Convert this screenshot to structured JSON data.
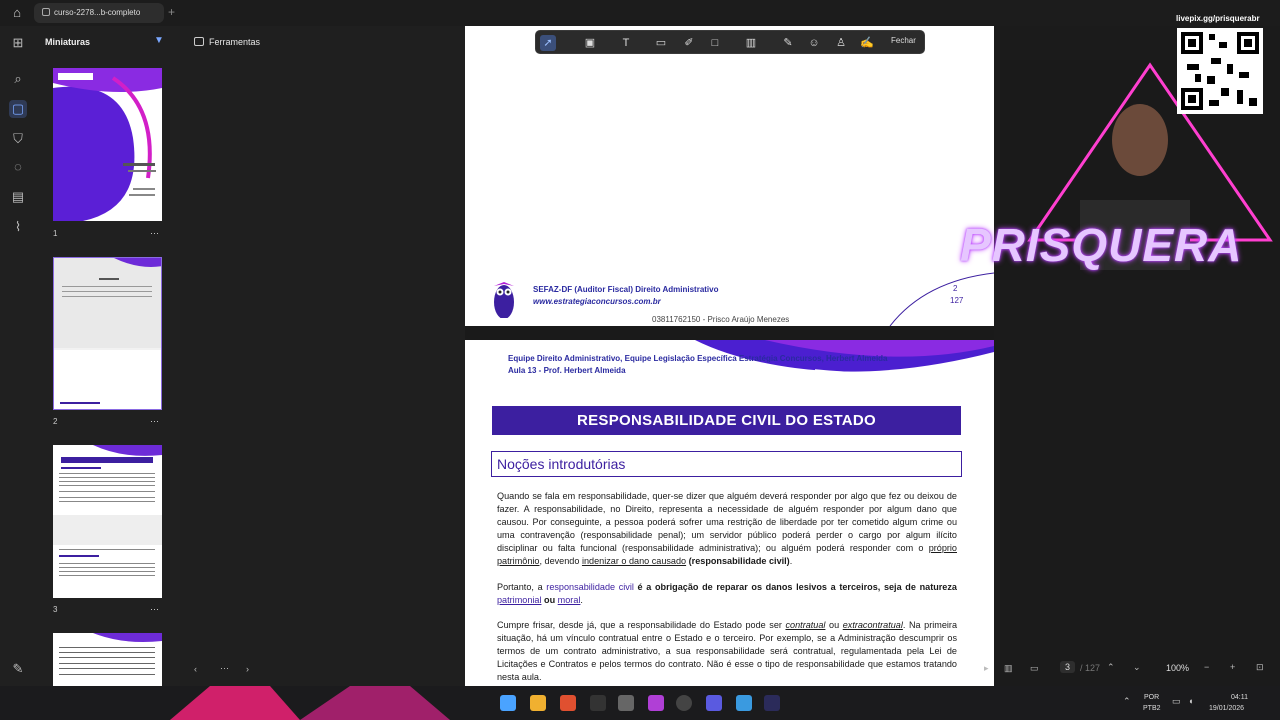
{
  "titlebar": {
    "tab_title": "curso-2278...b-completo",
    "new_tab": "+"
  },
  "thumbnails": {
    "title": "Miniaturas",
    "items": [
      {
        "page": "1",
        "more": "⋯"
      },
      {
        "page": "2",
        "more": "⋯"
      },
      {
        "page": "3",
        "more": "⋯"
      }
    ]
  },
  "tools": {
    "label": "Ferramentas"
  },
  "annotation_toolbar": {
    "close_label": "Fechar"
  },
  "page2_footer": {
    "course": "SEFAZ-DF (Auditor Fiscal) Direito Administrativo",
    "site": "www.estrategiaconcursos.com.br",
    "watermark": "03811762150 - Prisco Araújo Menezes",
    "page_num": "2",
    "page_total": "127"
  },
  "page3": {
    "header_line1": "Equipe Direito Administrativo, Equipe Legislação Específica Estratégia Concursos, Herbert Almeida",
    "header_line2": "Aula 13 - Prof. Herbert Almeida",
    "banner": "RESPONSABILIDADE CIVIL DO ESTADO",
    "section": "Noções introdutórias",
    "p1": "Quando se fala em responsabilidade, quer-se dizer que alguém deverá responder por algo que fez ou deixou de fazer. A responsabilidade, no Direito, representa a necessidade de alguém responder por algum dano que causou. Por conseguinte, a pessoa poderá sofrer uma restrição de liberdade por ter cometido algum crime ou uma contravenção (responsabilidade penal); um servidor público poderá perder o cargo por algum ilícito disciplinar ou falta funcional (responsabilidade administrativa); ou alguém poderá responder com o",
    "p1_u1": "próprio patrimônio",
    "p1_mid": ", devendo",
    "p1_u2": "indenizar o dano causado",
    "p1_b": "(responsabilidade civil)",
    "p1_end": ".",
    "p2_a": "Portanto, a",
    "p2_blue": "responsabilidade civil",
    "p2_b": "é a obrigação de reparar os danos lesivos a terceiros, seja de natureza",
    "p2_u1": "patrimonial",
    "p2_or": "ou",
    "p2_u2": "moral",
    "p2_end": ".",
    "p3_a": "Cumpre frisar, desde já, que a responsabilidade do Estado pode ser",
    "p3_i1": "contratual",
    "p3_or": "ou",
    "p3_i2": "extracontratual",
    "p3_rest": ". Na primeira situação, há um vínculo contratual entre o Estado e o terceiro. Por exemplo, se a Administração descumprir os termos de um contrato administrativo, a sua responsabilidade será contratual, regulamentada pela Lei de Licitações e Contratos e pelos termos do contrato. Não é esse o tipo de responsabilidade que estamos tratando nesta aula."
  },
  "statusbar": {
    "page_current": "3",
    "page_total": "/ 127",
    "zoom": "100%"
  },
  "taskbar": {
    "lang1": "POR",
    "lang2": "PTB2",
    "time": "04:11",
    "date": "19/01/2026"
  },
  "overlay": {
    "livepix": "livepix.gg/prisquerabr",
    "name": "PRISQUERA"
  }
}
